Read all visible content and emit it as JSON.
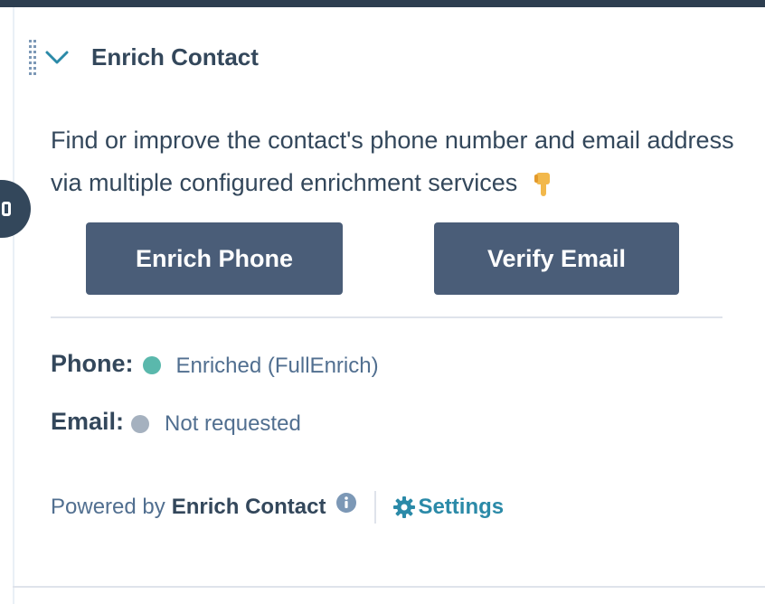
{
  "card": {
    "title": "Enrich Contact",
    "description": "Find or improve the contact's phone number and email address via multiple configured enrichment services"
  },
  "actions": {
    "enrich_phone_label": "Enrich Phone",
    "verify_email_label": "Verify Email"
  },
  "status": {
    "phone": {
      "label": "Phone:",
      "text": "Enriched (FullEnrich)",
      "color": "#5ab8ac"
    },
    "email": {
      "label": "Email:",
      "text": "Not requested",
      "color": "#a5b1bf"
    }
  },
  "footer": {
    "powered_by": "Powered by",
    "brand": "Enrich Contact",
    "settings_label": "Settings"
  },
  "icons": {
    "collapse": "chevron-down-icon",
    "drag": "drag-handle-icon",
    "emoji": "pointing-down-emoji",
    "info": "info-icon",
    "settings": "gear-icon"
  },
  "colors": {
    "button_bg": "#4a5d78",
    "text_primary": "#33475b",
    "link": "#2b8aa8",
    "header_bar": "#2d3e50"
  }
}
